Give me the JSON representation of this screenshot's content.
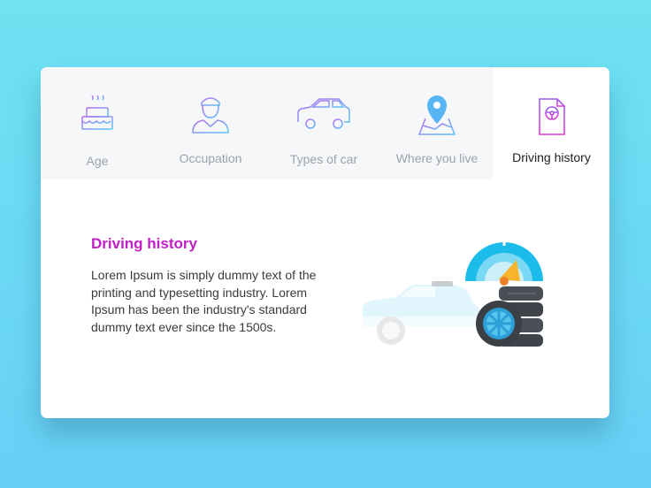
{
  "tabs": [
    {
      "label": "Age",
      "icon": "birthday-cake-icon",
      "active": false
    },
    {
      "label": "Occupation",
      "icon": "person-cap-icon",
      "active": false
    },
    {
      "label": "Types of car",
      "icon": "car-outline-icon",
      "active": false
    },
    {
      "label": "Where you live",
      "icon": "map-pin-icon",
      "active": false
    },
    {
      "label": "Driving history",
      "icon": "document-steering-wheel-icon",
      "active": true
    }
  ],
  "panel": {
    "title": "Driving history",
    "body": "Lorem Ipsum is simply dummy text of the printing and typesetting industry. Lorem Ipsum has been the industry's standard dummy text ever since the 1500s.",
    "illustration": "car-speedometer-tires-illustration"
  },
  "colors": {
    "background_top": "#6fe3f2",
    "background_bottom": "#68cff6",
    "title_accent": "#c21fc8",
    "icon_gradient_start": "#e05cf0",
    "icon_gradient_end": "#56b5f2"
  }
}
